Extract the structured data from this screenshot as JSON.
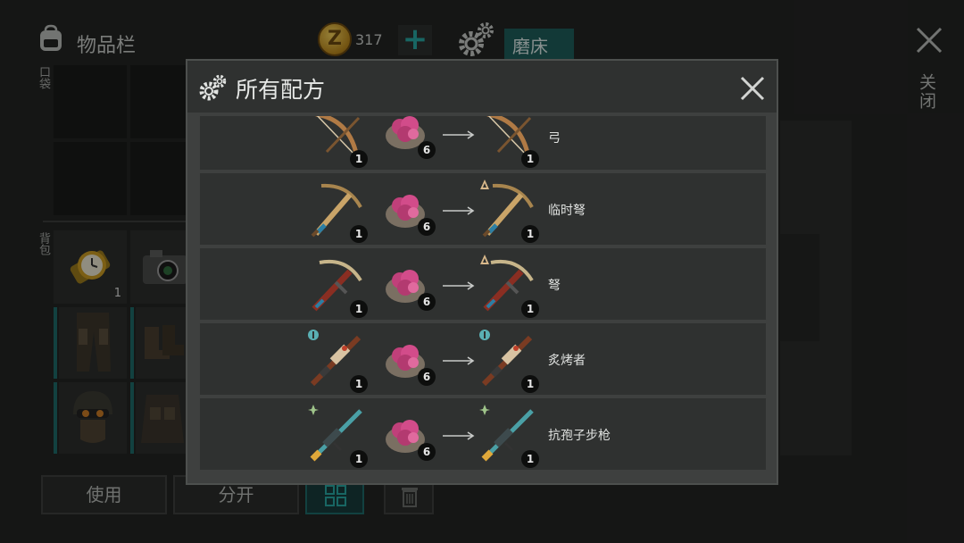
{
  "inventory": {
    "title": "物品栏",
    "coins": "317",
    "coin_glyph": "Z",
    "station_tab": "磨床",
    "close_label": "关闭",
    "pocket_label": "口袋",
    "backpack_label": "背包",
    "watch_count": "1",
    "buttons": {
      "use": "使用",
      "split": "分开"
    }
  },
  "modal": {
    "title": "所有配方",
    "recipes": [
      {
        "result": "弓",
        "weapon_count": "1",
        "material_count": "6",
        "result_count": "1",
        "weapon": "bow-icon",
        "result_icon": "bow-icon"
      },
      {
        "result": "临时弩",
        "weapon_count": "1",
        "material_count": "6",
        "result_count": "1",
        "weapon": "makeshift-crossbow-icon",
        "result_icon": "makeshift-crossbow-icon"
      },
      {
        "result": "弩",
        "weapon_count": "1",
        "material_count": "6",
        "result_count": "1",
        "weapon": "crossbow-icon",
        "result_icon": "crossbow-icon"
      },
      {
        "result": "炙烤者",
        "weapon_count": "1",
        "material_count": "6",
        "result_count": "1",
        "weapon": "griller-rifle-icon",
        "result_icon": "griller-rifle-icon"
      },
      {
        "result": "抗孢子步枪",
        "weapon_count": "1",
        "material_count": "6",
        "result_count": "1",
        "weapon": "anti-spore-rifle-icon",
        "result_icon": "anti-spore-rifle-icon"
      }
    ]
  },
  "colors": {
    "accent_teal": "#1d6968",
    "background": "#232423",
    "modal_row": "#2f3130",
    "material_pink": "#c0407a"
  }
}
